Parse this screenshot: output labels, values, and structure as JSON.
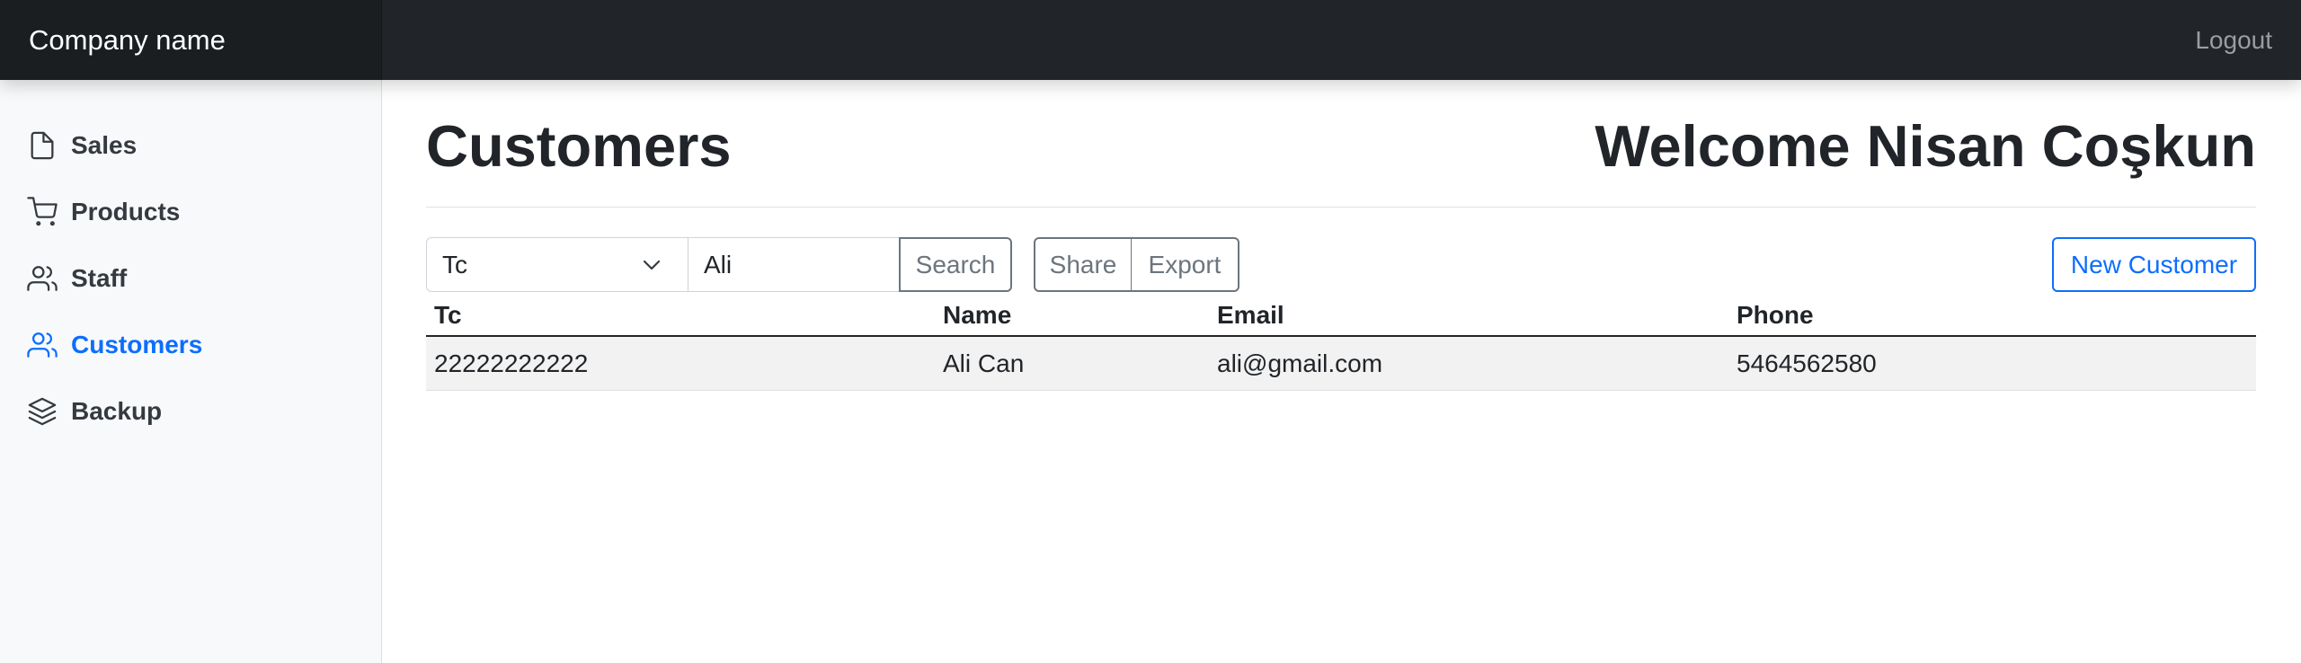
{
  "navbar": {
    "brand": "Company name",
    "logout_label": "Logout"
  },
  "sidebar": {
    "items": [
      {
        "label": "Sales",
        "icon": "file-icon",
        "active": false
      },
      {
        "label": "Products",
        "icon": "cart-icon",
        "active": false
      },
      {
        "label": "Staff",
        "icon": "users-icon",
        "active": false
      },
      {
        "label": "Customers",
        "icon": "users-icon",
        "active": true
      },
      {
        "label": "Backup",
        "icon": "layers-icon",
        "active": false
      }
    ]
  },
  "header": {
    "title": "Customers",
    "welcome": "Welcome Nisan Coşkun"
  },
  "toolbar": {
    "filter_field": "Tc",
    "search_value": "Ali",
    "search_label": "Search",
    "share_label": "Share",
    "export_label": "Export",
    "new_label": "New Customer"
  },
  "table": {
    "headers": [
      "Tc",
      "Name",
      "Email",
      "Phone"
    ],
    "rows": [
      [
        "22222222222",
        "Ali Can",
        "ali@gmail.com",
        "5464562580"
      ]
    ]
  },
  "colors": {
    "accent": "#0d6efd",
    "navbar": "#212529",
    "sidebar": "#f8f9fa"
  }
}
